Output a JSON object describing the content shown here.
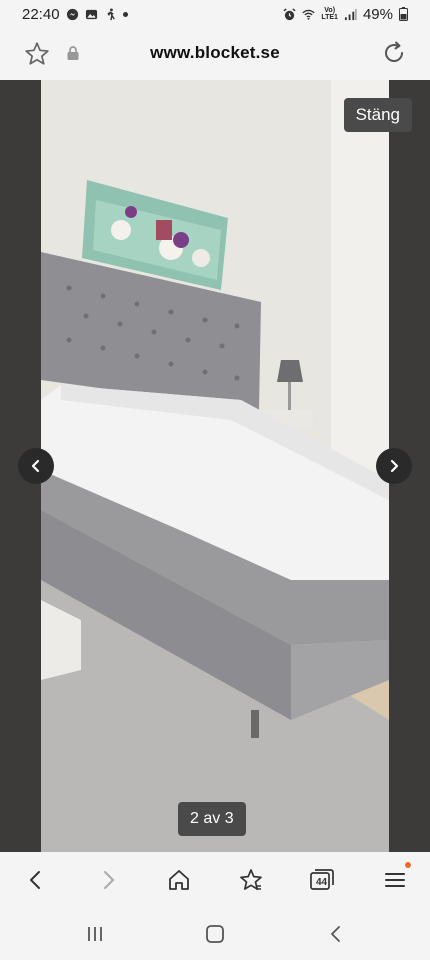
{
  "status_bar": {
    "time": "22:40",
    "network": "LTE1",
    "network_top": "Vo)",
    "battery": "49%",
    "icons": [
      "messenger-icon",
      "gallery-icon",
      "walking-icon",
      "alarm-icon",
      "wifi-icon",
      "signal-icon",
      "battery-icon"
    ]
  },
  "url_bar": {
    "url": "www.blocket.se",
    "icons": [
      "star-icon",
      "lock-icon",
      "reload-icon"
    ]
  },
  "viewer": {
    "close_label": "Stäng",
    "counter": "2 av 3",
    "image_subject": "gray upholstered continental bed with tufted headboard and white sheet"
  },
  "toolbar": {
    "tabs_count": "44",
    "icons": [
      "back-icon",
      "forward-icon",
      "home-icon",
      "bookmarks-icon",
      "tabs-icon",
      "menu-icon"
    ]
  },
  "colors": {
    "viewer_bg": "#3c3b39",
    "bar_bg": "#f4f4f4",
    "overlay_button": "#4a4a4a",
    "notification": "#f06a2b"
  }
}
